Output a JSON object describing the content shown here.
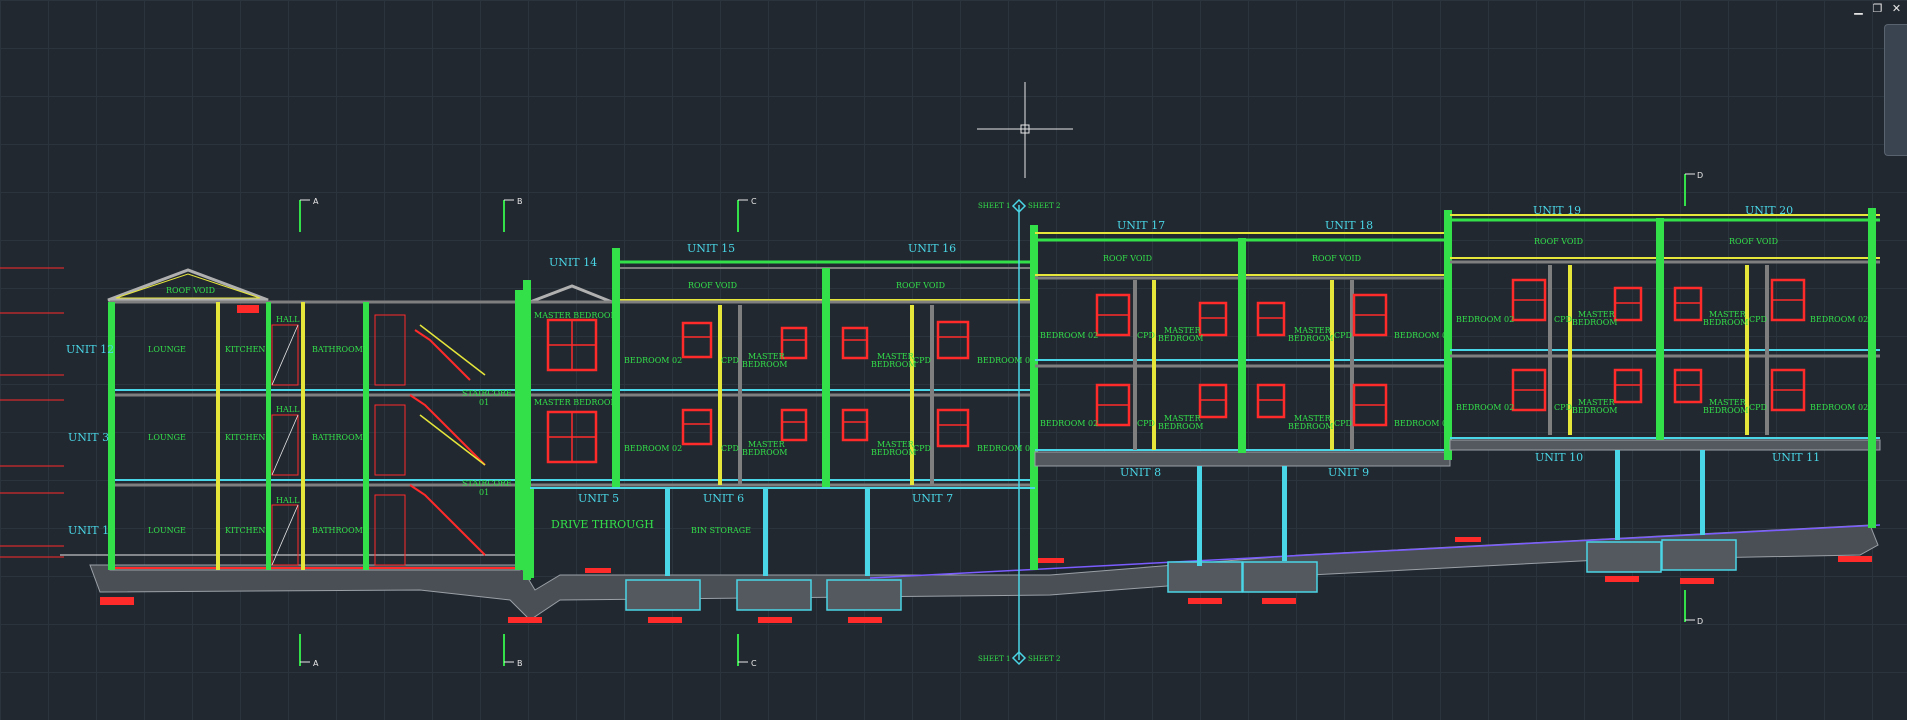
{
  "window_controls": {
    "minimize": "▁",
    "restore": "❐",
    "close": "✕"
  },
  "colors": {
    "background": "#212830",
    "green": "#33e04a",
    "cyan": "#4ad6e6",
    "red": "#ff2a2a",
    "yellow": "#e6e63a",
    "wall_gray": "#7f7f7f"
  },
  "grid_markers": {
    "a": "A",
    "b": "B",
    "c": "C",
    "d": "D"
  },
  "sheet_labels": {
    "sheet1": "SHEET 1",
    "sheet2": "SHEET 2"
  },
  "units": {
    "u1": "UNIT 1",
    "u3": "UNIT 3",
    "u5": "UNIT 5",
    "u6": "UNIT 6",
    "u7": "UNIT 7",
    "u8": "UNIT 8",
    "u9": "UNIT 9",
    "u10": "UNIT 10",
    "u11": "UNIT 11",
    "u12": "UNIT 12",
    "u14": "UNIT 14",
    "u15": "UNIT 15",
    "u16": "UNIT 16",
    "u17": "UNIT 17",
    "u18": "UNIT 18",
    "u19": "UNIT 19",
    "u20": "UNIT 20"
  },
  "rooms": {
    "roof_void": "ROOF VOID",
    "lounge": "LOUNGE",
    "kitchen": "KITCHEN",
    "hall": "HALL",
    "bathroom": "BATHROOM",
    "staircore": "STAIRCORE",
    "staircore_no": "01",
    "master_bedroom": "MASTER BEDROOM",
    "master": "MASTER",
    "bedroom": "BEDROOM",
    "bedroom_02": "BEDROOM 02",
    "cpd": "CPD",
    "drive_through": "DRIVE THROUGH",
    "bin_storage": "BIN STORAGE"
  }
}
